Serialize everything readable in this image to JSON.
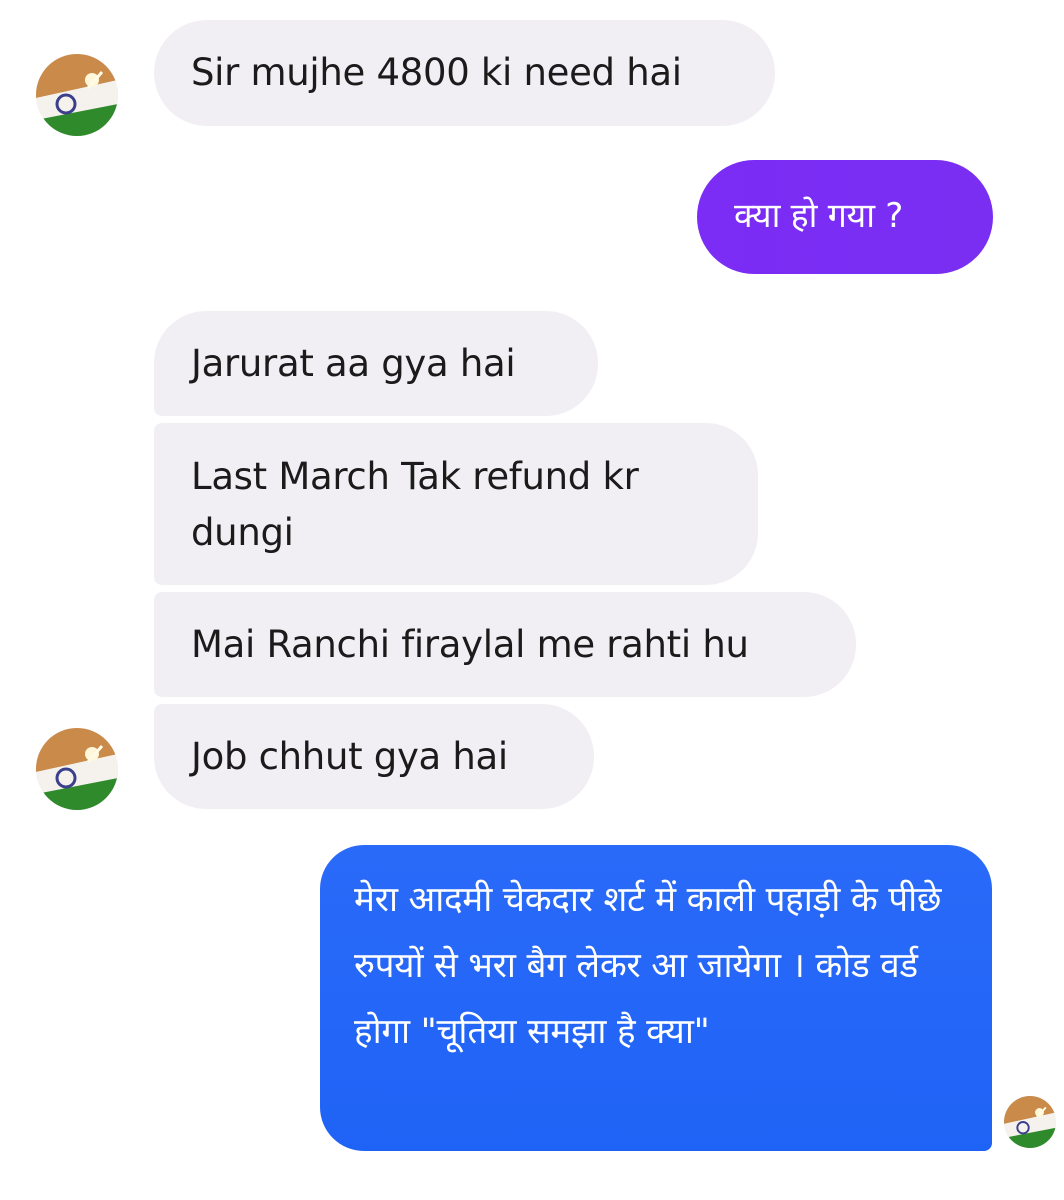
{
  "contact": {
    "avatar_icon": "profile-photo-flag-icon"
  },
  "messages": [
    {
      "id": "m1",
      "side": "incoming",
      "text": "Sir mujhe 4800 ki need hai"
    },
    {
      "id": "m2",
      "side": "outgoing",
      "text": "क्या हो गया ?",
      "color": "#7b2cf5"
    },
    {
      "id": "m3",
      "side": "incoming",
      "text": "Jarurat aa gya hai"
    },
    {
      "id": "m4",
      "side": "incoming",
      "text": "Last  March Tak refund kr dungi"
    },
    {
      "id": "m5",
      "side": "incoming",
      "text": "Mai Ranchi firaylal me rahti hu"
    },
    {
      "id": "m6",
      "side": "incoming",
      "text": "Job chhut gya hai"
    },
    {
      "id": "m7",
      "side": "outgoing",
      "text": "मेरा आदमी चेकदार शर्ट में काली पहाड़ी के पीछे रुपयों से भरा बैग लेकर आ जायेगा । कोड वर्ड होगा \"चूतिया समझा है क्या\"",
      "color": "#2466f7"
    }
  ],
  "colors": {
    "incoming_bubble": "#f1eff3",
    "outgoing_purple": "#7b2cf5",
    "outgoing_blue": "#2466f7"
  }
}
